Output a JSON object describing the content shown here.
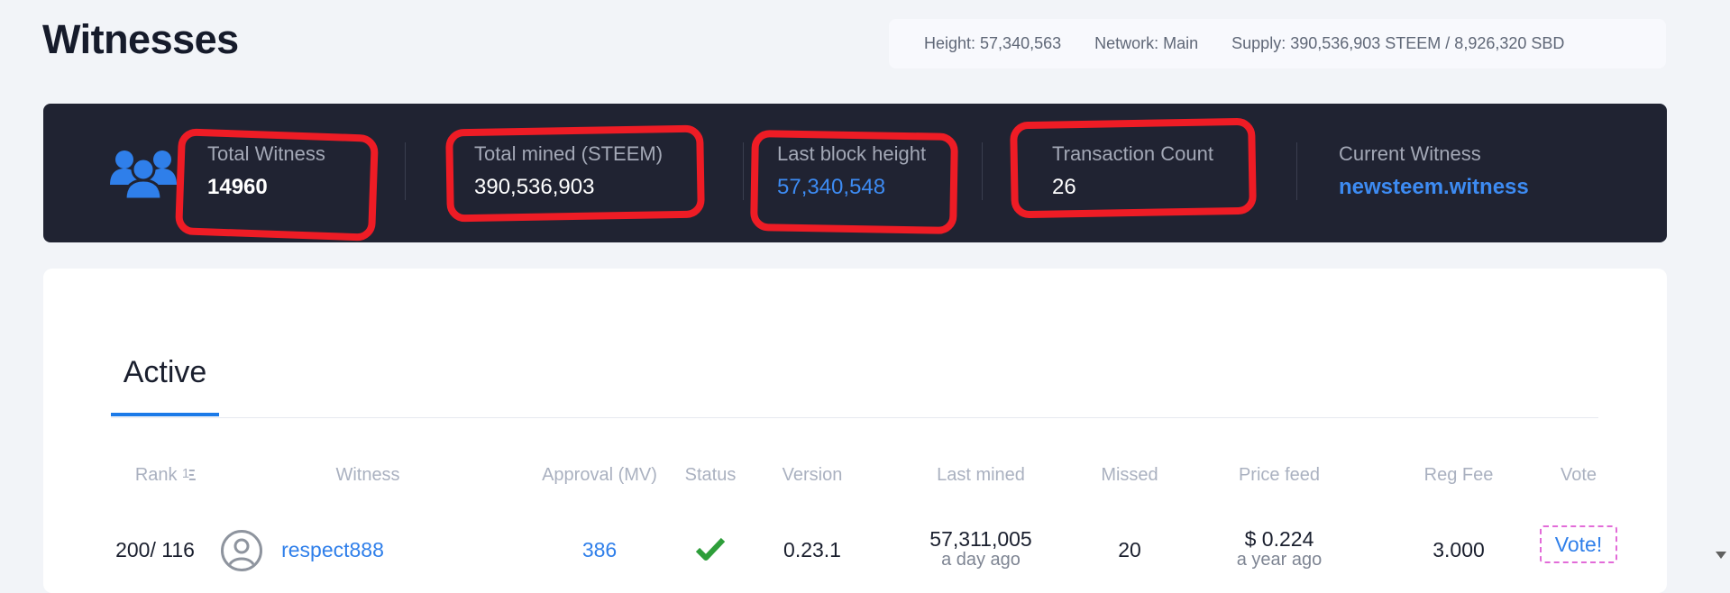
{
  "page": {
    "title": "Witnesses"
  },
  "network": {
    "height": "Height: 57,340,563",
    "network": "Network: Main",
    "supply": "Supply: 390,536,903 STEEM / 8,926,320 SBD"
  },
  "stats": {
    "icon": "users-icon",
    "total_witness_label": "Total Witness",
    "total_witness_value": "14960",
    "total_mined_label": "Total mined (STEEM)",
    "total_mined_value": "390,536,903",
    "last_block_label": "Last block height",
    "last_block_value": "57,340,548",
    "tx_count_label": "Transaction Count",
    "tx_count_value": "26",
    "current_witness_label": "Current Witness",
    "current_witness_value": "newsteem.witness"
  },
  "tabs": {
    "active": "Active"
  },
  "table": {
    "headers": {
      "rank": "Rank",
      "rank_sort_icon": "sort-ascending-icon",
      "witness": "Witness",
      "approval": "Approval (MV)",
      "status": "Status",
      "version": "Version",
      "last_mined": "Last mined",
      "missed": "Missed",
      "price_feed": "Price feed",
      "reg_fee": "Reg Fee",
      "vote": "Vote"
    },
    "rows": [
      {
        "rank": "200/ 116",
        "avatar_icon": "user-avatar-icon",
        "witness": "respect888",
        "approval": "386",
        "status_icon": "checkmark-icon",
        "version": "0.23.1",
        "last_mined": "57,311,005",
        "last_mined_ago": "a day ago",
        "missed": "20",
        "price_feed": "$ 0.224",
        "price_feed_ago": "a year ago",
        "reg_fee": "3.000",
        "vote": "Vote!"
      }
    ]
  },
  "colors": {
    "accent": "#2f7fea",
    "stats_bg": "#202332",
    "annotation_red": "#ee1c25",
    "status_ok": "#2e9e3a"
  }
}
